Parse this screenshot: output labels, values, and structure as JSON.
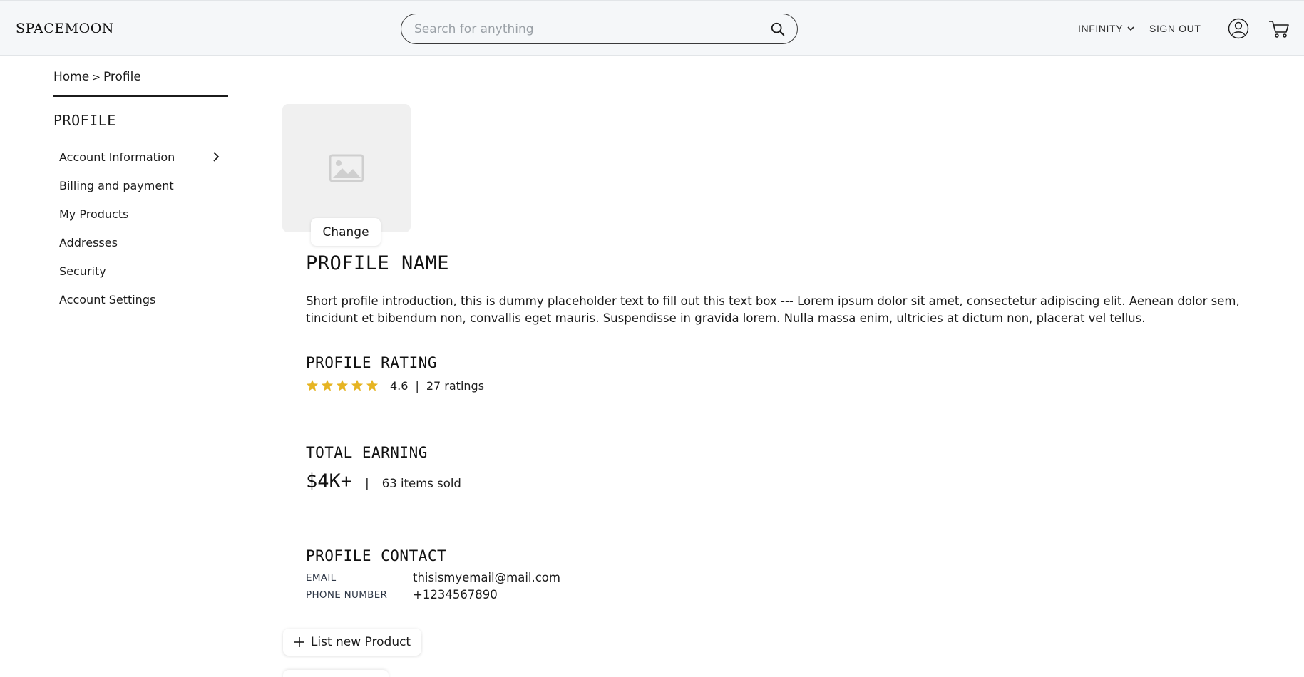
{
  "header": {
    "logo": "SPACEMOON",
    "search_placeholder": "Search for anything",
    "nav_infinity": "INFINITY",
    "nav_signout": "SIGN OUT"
  },
  "breadcrumb": {
    "home": "Home",
    "separator": ">",
    "current": "Profile"
  },
  "sidebar": {
    "title": "PROFILE",
    "items": [
      {
        "label": "Account Information"
      },
      {
        "label": "Billing and payment"
      },
      {
        "label": "My Products"
      },
      {
        "label": "Addresses"
      },
      {
        "label": "Security"
      },
      {
        "label": "Account Settings"
      }
    ]
  },
  "profile": {
    "change_label": "Change",
    "name": "PROFILE NAME",
    "intro": "Short profile introduction, this is dummy placeholder text to fill out this text box --- Lorem ipsum dolor sit amet, consectetur adipiscing elit. Aenean dolor sem, tincidunt et bibendum non, convallis eget mauris. Suspendisse in gravida lorem. Nulla massa enim, ultricies at dictum non, placerat vel tellus."
  },
  "rating": {
    "title": "PROFILE RATING",
    "value": "4.6",
    "separator": "|",
    "count": "27 ratings",
    "stars": 5,
    "star_color": "#e6b422"
  },
  "earning": {
    "title": "TOTAL EARNING",
    "amount": "$4K+",
    "separator": "|",
    "sold": "63 items sold"
  },
  "contact": {
    "title": "PROFILE CONTACT",
    "email_label": "EMAIL",
    "email_value": "thisismyemail@mail.com",
    "phone_label": "PHONE NUMBER",
    "phone_value": "+1234567890"
  },
  "actions": {
    "list_new_product": "List new Product"
  }
}
